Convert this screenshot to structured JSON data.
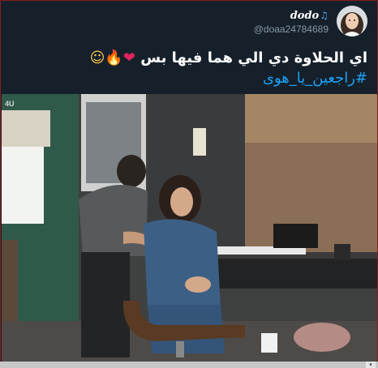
{
  "tweet": {
    "display_name": "dodo",
    "handle": "@doaa24784689",
    "text": "اي الحلاوة دي الي هما فيها بس",
    "hashtag": "#راجعين_يا_هوى",
    "media": {
      "channel_badge": "4U"
    }
  },
  "icons": {
    "display_name_emoji": "music-notes-icon",
    "text_emojis": [
      "red-heart-icon",
      "fire-icon",
      "smiling-face-icon"
    ],
    "scroll_arrow": "chevron-down-icon"
  },
  "colors": {
    "background": "#15202b",
    "text": "#ffffff",
    "secondary_text": "#8899a6",
    "link": "#1da1f2",
    "border": "#8a1c1c"
  }
}
